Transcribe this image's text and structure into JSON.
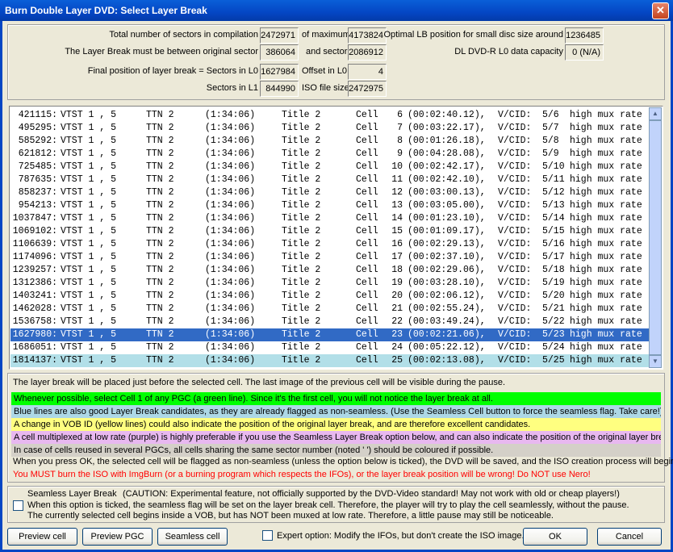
{
  "window": {
    "title": "Burn Double Layer DVD:  Select Layer Break",
    "close_glyph": "✕"
  },
  "info": {
    "total_label": "Total number of sectors in compilation",
    "total_value": "2472971",
    "max_label": "of maximum",
    "max_value": "4173824",
    "optimal_label": "Optimal LB position for small disc size around",
    "optimal_value": "1236485",
    "between_label": "The Layer Break must be between original sector",
    "between_value": "386064",
    "and_sector_label": "and sector",
    "and_sector_value": "2086912",
    "dl_label": "DL DVD-R L0 data capacity",
    "dl_value": "0 (N/A)",
    "final_label": "Final position of layer break = Sectors in L0",
    "final_value": "1627984",
    "offset_label": "Offset in L0",
    "offset_value": "4",
    "l1_label": "Sectors in L1",
    "l1_value": "844990",
    "iso_label": "ISO file size",
    "iso_value": "2472975"
  },
  "cells": [
    {
      "sector": "421115:",
      "vts": "VTST 1 , 5",
      "ttn": "TTN 2",
      "time": "(1:34:06)",
      "title": "Title 2",
      "cell": "Cell",
      "num": "6",
      "dur": "(00:02:40.12),",
      "vcid": "V/CID:",
      "ratio": "5/6",
      "mux": "high mux rate"
    },
    {
      "sector": "495295:",
      "vts": "VTST 1 , 5",
      "ttn": "TTN 2",
      "time": "(1:34:06)",
      "title": "Title 2",
      "cell": "Cell",
      "num": "7",
      "dur": "(00:03:22.17),",
      "vcid": "V/CID:",
      "ratio": "5/7",
      "mux": "high mux rate"
    },
    {
      "sector": "585292:",
      "vts": "VTST 1 , 5",
      "ttn": "TTN 2",
      "time": "(1:34:06)",
      "title": "Title 2",
      "cell": "Cell",
      "num": "8",
      "dur": "(00:01:26.18),",
      "vcid": "V/CID:",
      "ratio": "5/8",
      "mux": "high mux rate"
    },
    {
      "sector": "621812:",
      "vts": "VTST 1 , 5",
      "ttn": "TTN 2",
      "time": "(1:34:06)",
      "title": "Title 2",
      "cell": "Cell",
      "num": "9",
      "dur": "(00:04:28.08),",
      "vcid": "V/CID:",
      "ratio": "5/9",
      "mux": "high mux rate"
    },
    {
      "sector": "725485:",
      "vts": "VTST 1 , 5",
      "ttn": "TTN 2",
      "time": "(1:34:06)",
      "title": "Title 2",
      "cell": "Cell",
      "num": "10",
      "dur": "(00:02:42.17),",
      "vcid": "V/CID:",
      "ratio": "5/10",
      "mux": "high mux rate"
    },
    {
      "sector": "787635:",
      "vts": "VTST 1 , 5",
      "ttn": "TTN 2",
      "time": "(1:34:06)",
      "title": "Title 2",
      "cell": "Cell",
      "num": "11",
      "dur": "(00:02:42.10),",
      "vcid": "V/CID:",
      "ratio": "5/11",
      "mux": "high mux rate"
    },
    {
      "sector": "858237:",
      "vts": "VTST 1 , 5",
      "ttn": "TTN 2",
      "time": "(1:34:06)",
      "title": "Title 2",
      "cell": "Cell",
      "num": "12",
      "dur": "(00:03:00.13),",
      "vcid": "V/CID:",
      "ratio": "5/12",
      "mux": "high mux rate"
    },
    {
      "sector": "954213:",
      "vts": "VTST 1 , 5",
      "ttn": "TTN 2",
      "time": "(1:34:06)",
      "title": "Title 2",
      "cell": "Cell",
      "num": "13",
      "dur": "(00:03:05.00),",
      "vcid": "V/CID:",
      "ratio": "5/13",
      "mux": "high mux rate"
    },
    {
      "sector": "1037847:",
      "vts": "VTST 1 , 5",
      "ttn": "TTN 2",
      "time": "(1:34:06)",
      "title": "Title 2",
      "cell": "Cell",
      "num": "14",
      "dur": "(00:01:23.10),",
      "vcid": "V/CID:",
      "ratio": "5/14",
      "mux": "high mux rate"
    },
    {
      "sector": "1069102:",
      "vts": "VTST 1 , 5",
      "ttn": "TTN 2",
      "time": "(1:34:06)",
      "title": "Title 2",
      "cell": "Cell",
      "num": "15",
      "dur": "(00:01:09.17),",
      "vcid": "V/CID:",
      "ratio": "5/15",
      "mux": "high mux rate"
    },
    {
      "sector": "1106639:",
      "vts": "VTST 1 , 5",
      "ttn": "TTN 2",
      "time": "(1:34:06)",
      "title": "Title 2",
      "cell": "Cell",
      "num": "16",
      "dur": "(00:02:29.13),",
      "vcid": "V/CID:",
      "ratio": "5/16",
      "mux": "high mux rate"
    },
    {
      "sector": "1174096:",
      "vts": "VTST 1 , 5",
      "ttn": "TTN 2",
      "time": "(1:34:06)",
      "title": "Title 2",
      "cell": "Cell",
      "num": "17",
      "dur": "(00:02:37.10),",
      "vcid": "V/CID:",
      "ratio": "5/17",
      "mux": "high mux rate"
    },
    {
      "sector": "1239257:",
      "vts": "VTST 1 , 5",
      "ttn": "TTN 2",
      "time": "(1:34:06)",
      "title": "Title 2",
      "cell": "Cell",
      "num": "18",
      "dur": "(00:02:29.06),",
      "vcid": "V/CID:",
      "ratio": "5/18",
      "mux": "high mux rate"
    },
    {
      "sector": "1312386:",
      "vts": "VTST 1 , 5",
      "ttn": "TTN 2",
      "time": "(1:34:06)",
      "title": "Title 2",
      "cell": "Cell",
      "num": "19",
      "dur": "(00:03:28.10),",
      "vcid": "V/CID:",
      "ratio": "5/19",
      "mux": "high mux rate"
    },
    {
      "sector": "1403241:",
      "vts": "VTST 1 , 5",
      "ttn": "TTN 2",
      "time": "(1:34:06)",
      "title": "Title 2",
      "cell": "Cell",
      "num": "20",
      "dur": "(00:02:06.12),",
      "vcid": "V/CID:",
      "ratio": "5/20",
      "mux": "high mux rate"
    },
    {
      "sector": "1462028:",
      "vts": "VTST 1 , 5",
      "ttn": "TTN 2",
      "time": "(1:34:06)",
      "title": "Title 2",
      "cell": "Cell",
      "num": "21",
      "dur": "(00:02:55.24),",
      "vcid": "V/CID:",
      "ratio": "5/21",
      "mux": "high mux rate"
    },
    {
      "sector": "1536758:",
      "vts": "VTST 1 , 5",
      "ttn": "TTN 2",
      "time": "(1:34:06)",
      "title": "Title 2",
      "cell": "Cell",
      "num": "22",
      "dur": "(00:03:49.24),",
      "vcid": "V/CID:",
      "ratio": "5/22",
      "mux": "high mux rate"
    },
    {
      "sector": "1627980:",
      "vts": "VTST 1 , 5",
      "ttn": "TTN 2",
      "time": "(1:34:06)",
      "title": "Title 2",
      "cell": "Cell",
      "num": "23",
      "dur": "(00:02:21.06),",
      "vcid": "V/CID:",
      "ratio": "5/23",
      "mux": "high mux rate"
    },
    {
      "sector": "1686051:",
      "vts": "VTST 1 , 5",
      "ttn": "TTN 2",
      "time": "(1:34:06)",
      "title": "Title 2",
      "cell": "Cell",
      "num": "24",
      "dur": "(00:05:22.12),",
      "vcid": "V/CID:",
      "ratio": "5/24",
      "mux": "high mux rate"
    },
    {
      "sector": "1814137:",
      "vts": "VTST 1 , 5",
      "ttn": "TTN 2",
      "time": "(1:34:06)",
      "title": "Title 2",
      "cell": "Cell",
      "num": "25",
      "dur": "(00:02:13.08),",
      "vcid": "V/CID:",
      "ratio": "5/25",
      "mux": "high mux rate"
    }
  ],
  "selected_index": 17,
  "highlighted_index": 19,
  "scroll": {
    "up_glyph": "▲",
    "down_glyph": "▼"
  },
  "legend": {
    "intro": "The layer break will be placed just before the selected cell.  The last image of the previous cell will be visible during the pause.",
    "green": "Whenever possible, select Cell 1 of any PGC (a green line).  Since it's the first cell, you will not notice the layer break at all.",
    "blue": "Blue lines are also good Layer Break candidates, as they are already flagged as non-seamless.  (Use the Seamless Cell button to force the seamless flag.  Take care!)",
    "yellow": "A change in VOB ID (yellow lines) could also indicate the position of the original layer break, and are therefore excellent candidates.",
    "purple": "A cell multiplexed at low rate (purple) is highly preferable if you use the Seamless Layer Break option below, and can also indicate the position of the original layer break.",
    "grey": "In case of cells reused in several PGCs, all cells sharing the same sector number (noted ' ') should be coloured if possible.",
    "ok_note": "When you press OK, the selected cell will be flagged as non-seamless (unless the option below is ticked), the DVD will be saved, and the ISO creation process will begin.",
    "warning": "You MUST burn the ISO with ImgBurn (or a burning program which respects the IFOs), or the layer break position will be wrong!  Do NOT use Nero!",
    "colors": {
      "green": "#00ff00",
      "blue": "#add8e6",
      "yellow": "#ffff80",
      "purple": "#e8b8f0",
      "grey": "#d4d0c8",
      "warning": "#ff0000"
    }
  },
  "seamless": {
    "label": "Seamless Layer Break",
    "caution": "(CAUTION:  Experimental feature, not officially supported by the DVD-Video standard!  May not work with old or cheap players!)",
    "line2": "When this option is ticked, the seamless flag will be set on the layer break cell.  Therefore, the player will try to play the cell seamlessly, without the pause.",
    "line3": "The currently selected cell begins inside a VOB, but has NOT been muxed at low rate.  Therefore, a little pause may still be noticeable."
  },
  "buttons": {
    "preview_cell": "Preview cell",
    "preview_pgc": "Preview PGC",
    "seamless_cell": "Seamless cell",
    "expert_label": "Expert option: Modify the IFOs, but don't create the ISO image.",
    "ok": "OK",
    "cancel": "Cancel"
  }
}
